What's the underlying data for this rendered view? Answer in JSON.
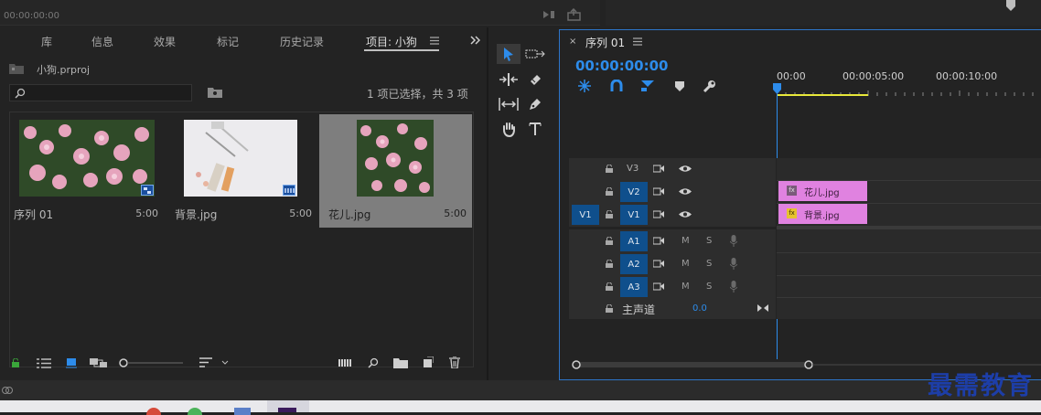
{
  "top": {
    "timecode": "00:00:00:00"
  },
  "project": {
    "tabs": [
      "库",
      "信息",
      "效果",
      "标记",
      "历史记录",
      "项目: 小狗"
    ],
    "file_name": "小狗.prproj",
    "search_placeholder": "",
    "selection_status": "1 项已选择，共 3 项",
    "items": [
      {
        "name": "序列 01",
        "duration": "5:00"
      },
      {
        "name": "背景.jpg",
        "duration": "5:00"
      },
      {
        "name": "花儿.jpg",
        "duration": "5:00"
      }
    ]
  },
  "sequence": {
    "tab_title": "序列 01",
    "timecode": "00:00:00:00",
    "ruler": [
      "00:00",
      "00:00:05:00",
      "00:00:10:00"
    ],
    "tracks": {
      "v3": "V3",
      "v2": "V2",
      "v1": "V1",
      "v1_source": "V1",
      "a1": "A1",
      "a2": "A2",
      "a3": "A3",
      "mute": "M",
      "solo": "S"
    },
    "master_label": "主声道",
    "master_value": "0.0",
    "clips": [
      {
        "name": "花儿.jpg",
        "track": "V2",
        "badge": "fx"
      },
      {
        "name": "背景.jpg",
        "track": "V1",
        "badge": "fx"
      }
    ]
  },
  "watermark": "最需教育",
  "colors": {
    "accent": "#2d8ceb",
    "clip": "#e082e0",
    "track_button": "#0f4f8c",
    "playhead": "#2d8ceb",
    "work_area": "#e8e83a"
  }
}
